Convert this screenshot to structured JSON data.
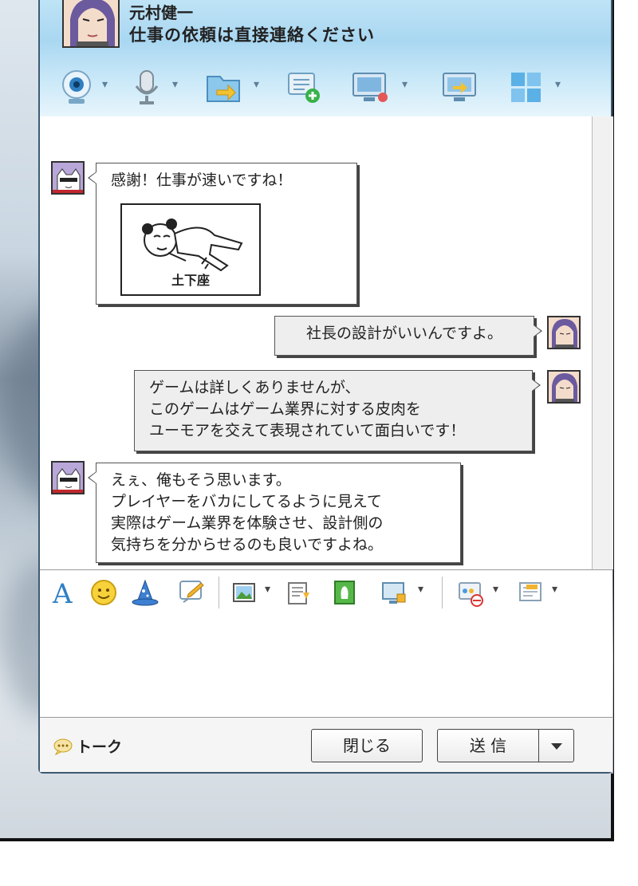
{
  "contact": {
    "name": "元村健一",
    "status": "仕事の依頼は直接連絡ください"
  },
  "toolbar": {
    "icons": [
      "webcam-icon",
      "microphone-icon",
      "file-transfer-icon",
      "new-message-icon",
      "screen-share-icon",
      "remote-desktop-icon",
      "apps-grid-icon"
    ]
  },
  "messages": [
    {
      "from": "other",
      "lines": [
        "感謝！仕事が速いですね！"
      ],
      "sticker_caption": "土下座"
    },
    {
      "from": "me",
      "lines": [
        "社長の設計がいいんですよ。"
      ]
    },
    {
      "from": "me",
      "lines": [
        "ゲームは詳しくありませんが、",
        "このゲームはゲーム業界に対する皮肉を",
        "ユーモアを交えて表現されていて面白いです！"
      ]
    },
    {
      "from": "other",
      "lines": [
        "えぇ、俺もそう思います。",
        "プレイヤーをバカにしてるように見えて",
        "実際はゲーム業界を体験させ、設計側の",
        "気持ちを分からせるのも良いですよね。"
      ]
    }
  ],
  "format_bar": {
    "icons": [
      "font-icon",
      "emoji-icon",
      "magic-hat-icon",
      "handwriting-icon",
      "image-icon",
      "screenshot-icon",
      "sticker-icon",
      "screen-capture-icon",
      "block-icon",
      "message-history-icon"
    ]
  },
  "footer": {
    "talk_label": "トーク",
    "close_label": "閉じる",
    "send_label": "送 信"
  },
  "colors": {
    "titlebar": "#a9d7f1",
    "border": "#3d5b72",
    "my_bubble": "#eeeeee"
  }
}
